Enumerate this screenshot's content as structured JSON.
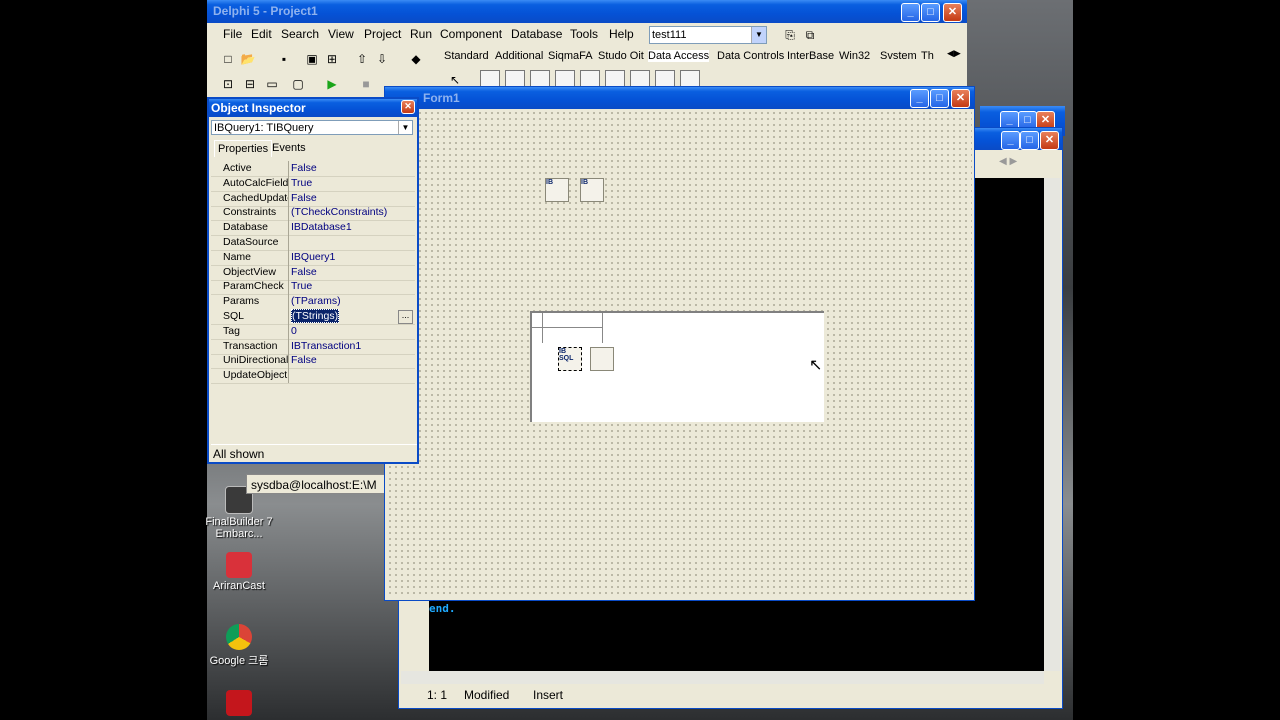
{
  "ide": {
    "title": "Delphi 5 - Project1",
    "menu": [
      "File",
      "Edit",
      "Search",
      "View",
      "Project",
      "Run",
      "Component",
      "Database",
      "Tools",
      "Help"
    ],
    "config_value": "test111",
    "palette_tabs": [
      "Standard",
      "Additional",
      "SiqmaFA",
      "Studo Oit",
      "Data Access",
      "Data Controls",
      "InterBase",
      "Win32",
      "Svstem",
      "Th"
    ]
  },
  "object_inspector": {
    "title": "Object Inspector",
    "selected_object": "IBQuery1: TIBQuery",
    "tabs": [
      "Properties",
      "Events"
    ],
    "properties": [
      {
        "name": "Active",
        "value": "False"
      },
      {
        "name": "AutoCalcFields",
        "value": "True"
      },
      {
        "name": "CachedUpdates",
        "value": "False"
      },
      {
        "name": "Constraints",
        "value": "(TCheckConstraints)"
      },
      {
        "name": "Database",
        "value": "IBDatabase1"
      },
      {
        "name": "DataSource",
        "value": ""
      },
      {
        "name": "Name",
        "value": "IBQuery1"
      },
      {
        "name": "ObjectView",
        "value": "False"
      },
      {
        "name": "ParamCheck",
        "value": "True"
      },
      {
        "name": "Params",
        "value": "(TParams)"
      },
      {
        "name": "SQL",
        "value": "(TStrings)"
      },
      {
        "name": "Tag",
        "value": "0"
      },
      {
        "name": "Transaction",
        "value": "IBTransaction1"
      },
      {
        "name": "UniDirectional",
        "value": "False"
      },
      {
        "name": "UpdateObject",
        "value": ""
      }
    ],
    "status": "All shown"
  },
  "form_designer": {
    "title": "Form1",
    "components": [
      "IB",
      "IB",
      "IB SQL"
    ]
  },
  "editor": {
    "code_line": "end.",
    "status_pos": "1:  1",
    "status_modified": "Modified",
    "status_mode": "Insert"
  },
  "desktop": {
    "icons": [
      "FinalBuilder 7 Embarc...",
      "AriranCast",
      "Google 크롬"
    ],
    "task_label": "sysdba@localhost:E:\\M"
  },
  "colors": {
    "title_blue": "#0552d6",
    "face": "#ece9d8",
    "selection": "#0a246a"
  }
}
